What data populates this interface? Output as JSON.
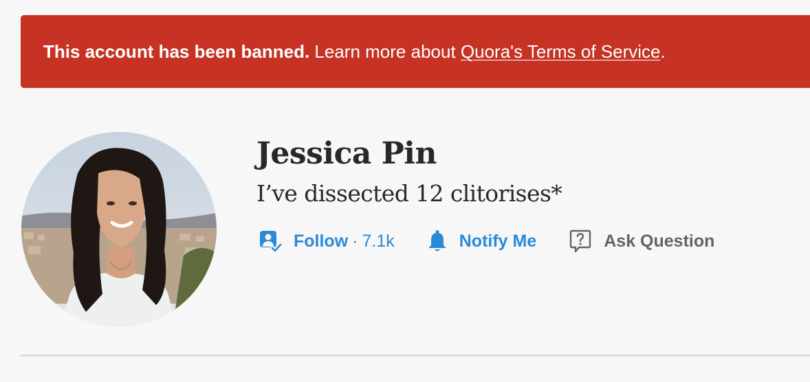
{
  "banner": {
    "strong_text": "This account has been banned.",
    "lead_text": "Learn more about",
    "link_text": "Quora's Terms of Service",
    "trailing": "."
  },
  "profile": {
    "name": "Jessica Pin",
    "credential": "I’ve dissected 12 clitorises*"
  },
  "actions": {
    "follow_label": "Follow",
    "follow_separator": "·",
    "follow_count": "7.1k",
    "notify_label": "Notify Me",
    "ask_label": "Ask Question"
  },
  "colors": {
    "banner_bg": "#c63324",
    "action_blue": "#2b8ad8",
    "action_gray": "#636466",
    "text_dark": "#282829",
    "page_bg": "#f7f7f7"
  },
  "icons": {
    "follow": "follow-user-icon",
    "notify": "bell-icon",
    "ask": "question-bubble-icon"
  }
}
